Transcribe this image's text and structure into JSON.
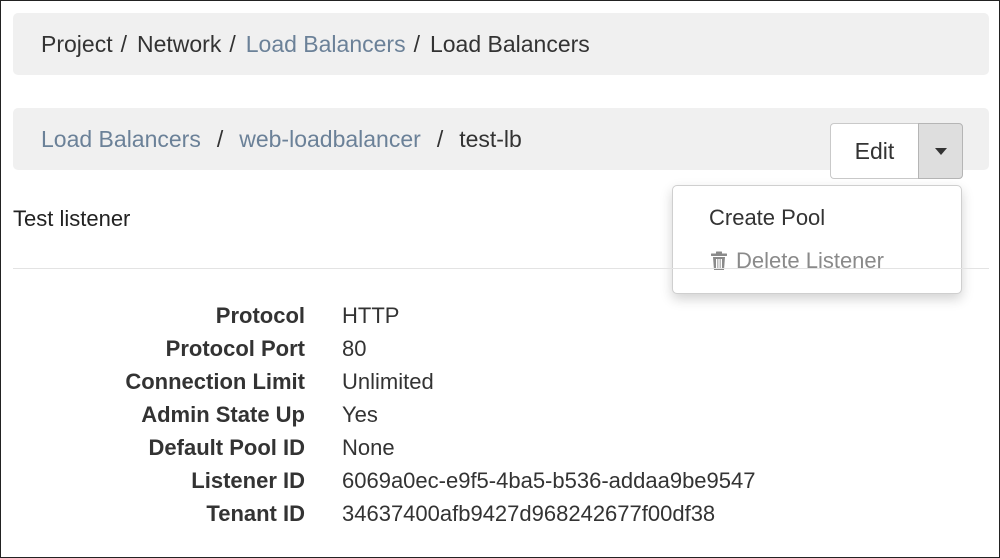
{
  "breadcrumb_top": {
    "items": [
      {
        "label": "Project",
        "link": false
      },
      {
        "label": "Network",
        "link": false
      },
      {
        "label": "Load Balancers",
        "link": true
      },
      {
        "label": "Load Balancers",
        "link": false
      }
    ],
    "separator": "/"
  },
  "breadcrumb_page": {
    "items": [
      {
        "label": "Load Balancers",
        "link": true
      },
      {
        "label": "web-loadbalancer",
        "link": true
      },
      {
        "label": "test-lb",
        "link": false
      }
    ],
    "separator": "/"
  },
  "actions": {
    "edit_label": "Edit",
    "caret_icon": "chevron-down-icon",
    "menu": [
      {
        "label": "Create Pool",
        "icon": null,
        "enabled": true
      },
      {
        "label": "Delete Listener",
        "icon": "trash-icon",
        "enabled": false
      }
    ]
  },
  "listener": {
    "description": "Test listener",
    "fields": [
      {
        "label": "Protocol",
        "value": "HTTP"
      },
      {
        "label": "Protocol Port",
        "value": "80"
      },
      {
        "label": "Connection Limit",
        "value": "Unlimited"
      },
      {
        "label": "Admin State Up",
        "value": "Yes"
      },
      {
        "label": "Default Pool ID",
        "value": "None"
      },
      {
        "label": "Listener ID",
        "value": "6069a0ec-e9f5-4ba5-b536-addaa9be9547"
      },
      {
        "label": "Tenant ID",
        "value": "34637400afb9427d968242677f00df38"
      }
    ]
  },
  "colors": {
    "link": "#6b8198",
    "text": "#333333",
    "bar_background": "#f0f0f0",
    "disabled_text": "#8a8a8a"
  }
}
